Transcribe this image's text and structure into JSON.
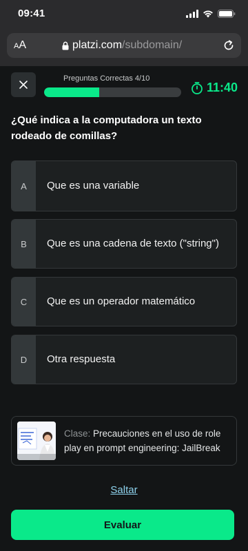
{
  "status_bar": {
    "time": "09:41"
  },
  "browser": {
    "aa_label_small": "A",
    "aa_label_large": "A",
    "url_host": "platzi.com",
    "url_path": "/subdomain/"
  },
  "quiz": {
    "progress_label": "Preguntas Correctas 4/10",
    "progress_fraction": 0.4,
    "timer": "11:40",
    "question": "¿Qué indica a la computadora un texto rodeado de comillas?",
    "options": [
      {
        "letter": "A",
        "text": "Que es una variable"
      },
      {
        "letter": "B",
        "text": "Que es una cadena de texto (\"string\")"
      },
      {
        "letter": "C",
        "text": "Que es un operador matemático"
      },
      {
        "letter": "D",
        "text": "Otra respuesta"
      }
    ]
  },
  "class_card": {
    "prefix": "Clase:",
    "title": "Precauciones en el uso de role play en prompt engineering: JailBreak"
  },
  "actions": {
    "skip": "Saltar",
    "evaluate": "Evaluar"
  },
  "colors": {
    "accent": "#0ae98a",
    "background": "#131516",
    "link": "#8fd3ee"
  }
}
